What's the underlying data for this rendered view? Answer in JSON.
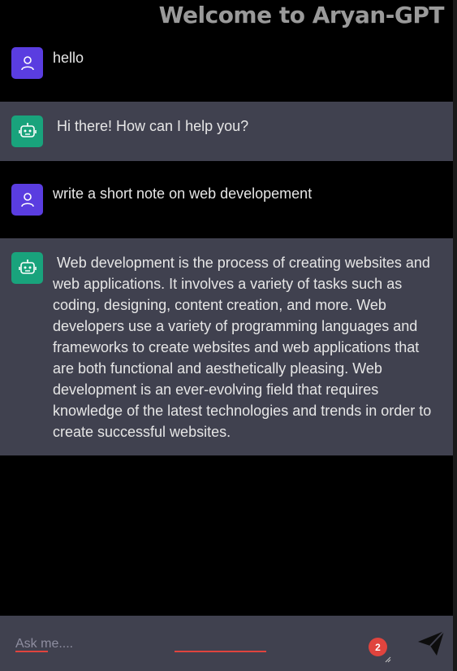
{
  "header": {
    "title": "Welcome to Aryan-GPT"
  },
  "messages": [
    {
      "role": "user",
      "avatar_icon": "user-icon",
      "text": "hello"
    },
    {
      "role": "ai",
      "avatar_icon": "robot-icon",
      "text": " Hi there! How can I help you?"
    },
    {
      "role": "user",
      "avatar_icon": "user-icon",
      "text": "write a short note on web developement"
    },
    {
      "role": "ai",
      "avatar_icon": "robot-icon",
      "text": " Web development is the process of creating websites and web applications. It involves a variety of tasks such as coding, designing, content creation, and more. Web developers use a variety of programming languages and frameworks to create websites and web applications that are both functional and aesthetically pleasing. Web development is an ever-evolving field that requires knowledge of the latest technologies and trends in order to create successful websites."
    }
  ],
  "composer": {
    "placeholder": "Ask me....",
    "value": "",
    "notification_count": "2",
    "send_icon": "send-icon"
  },
  "colors": {
    "background": "#000000",
    "ai_row": "#40414f",
    "user_avatar": "#5a3de0",
    "bot_avatar": "#19a37c",
    "title": "#9a9a9a",
    "accent_red": "#e0443e"
  }
}
